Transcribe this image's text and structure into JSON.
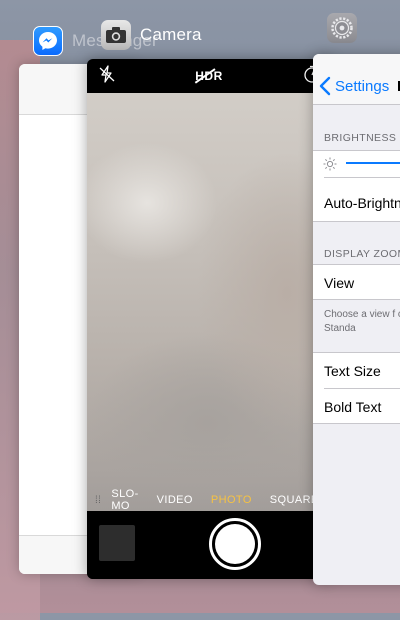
{
  "app_switcher": {
    "apps": [
      {
        "name": "Messenger",
        "icon": "messenger-icon"
      },
      {
        "name": "Camera",
        "icon": "camera-icon"
      },
      {
        "name": "Settings",
        "icon": "settings-gear-icon"
      }
    ]
  },
  "camera": {
    "modes": [
      "SLO-MO",
      "VIDEO",
      "PHOTO",
      "SQUARE"
    ],
    "active_mode": "PHOTO",
    "hdr_label": "HDR",
    "active_color": "#f6c243"
  },
  "settings": {
    "back_label": "Settings",
    "title_fragment": "D",
    "brightness_header": "BRIGHTNESS",
    "auto_brightness_label": "Auto-Brightn",
    "display_zoom_header": "DISPLAY ZOOM",
    "view_label": "View",
    "view_footer": "Choose a view f controls. Standa",
    "text_size_label": "Text Size",
    "bold_text_label": "Bold Text",
    "accent_color": "#0a7aff"
  }
}
